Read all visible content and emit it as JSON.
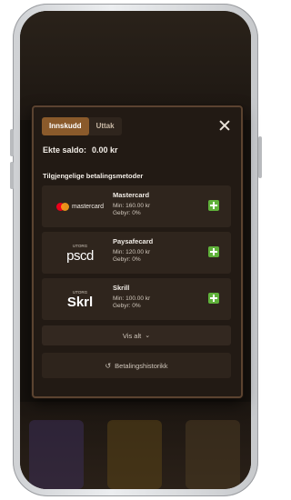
{
  "tabs": {
    "deposit": "Innskudd",
    "withdraw": "Uttak"
  },
  "balance": {
    "label": "Ekte saldo:",
    "value": "0.00 kr"
  },
  "methods_title": "Tilgjengelige betalingsmetoder",
  "methods": [
    {
      "name": "Mastercard",
      "min": "Min: 160.00 kr",
      "fee": "Gebyr: 0%",
      "logo_text": "mastercard"
    },
    {
      "name": "Paysafecard",
      "min": "Min: 120.00 kr",
      "fee": "Gebyr: 0%",
      "logo_text": "pscd",
      "tag": "UTORG"
    },
    {
      "name": "Skrill",
      "min": "Min: 100.00 kr",
      "fee": "Gebyr: 0%",
      "logo_text": "Skrl",
      "tag": "UTORG"
    }
  ],
  "show_all": "Vis alt",
  "history": "Betalingshistorikk",
  "colors": {
    "accent": "#8a5a2b",
    "plus": "#5fb13a",
    "panel": "#221a14",
    "row": "#2f251d"
  },
  "icons": {
    "close": "close-icon",
    "plus": "plus-icon",
    "chevron": "chevron-down-icon",
    "history": "history-icon"
  }
}
